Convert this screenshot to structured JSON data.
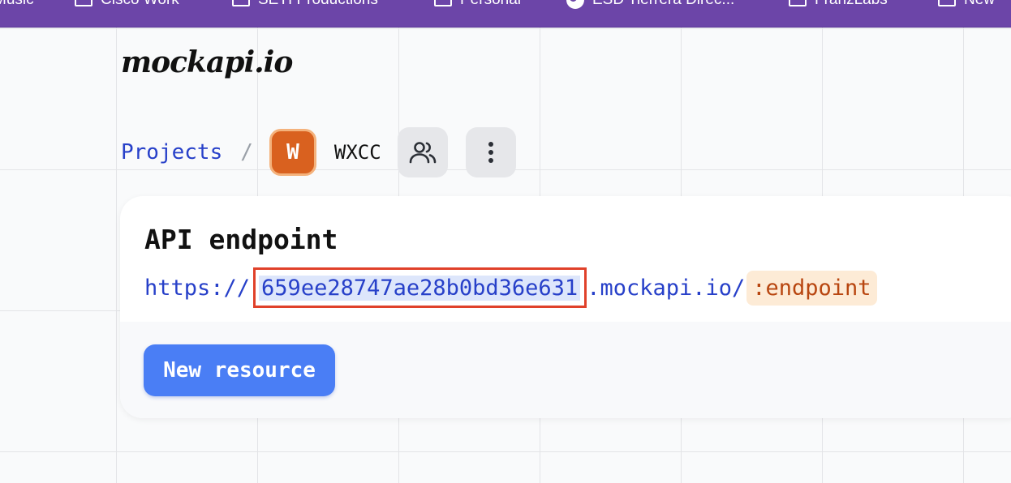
{
  "bookmarks": [
    {
      "label": "Music",
      "icon": "folder-icon"
    },
    {
      "label": "Cisco Work",
      "icon": "folder-icon"
    },
    {
      "label": "SETI Productions",
      "icon": "folder-icon"
    },
    {
      "label": "Personal",
      "icon": "folder-icon"
    },
    {
      "label": "ESD Tierrera Direc...",
      "icon": "globe-icon"
    },
    {
      "label": "FranzLabs",
      "icon": "folder-icon"
    },
    {
      "label": "New",
      "icon": "folder-icon"
    }
  ],
  "logo": "mockapi.io",
  "breadcrumb": {
    "projects_label": "Projects",
    "separator": "/",
    "avatar_letter": "W",
    "project_name": "WXCC",
    "members_icon": "users-icon",
    "menu_icon": "more-vertical-icon"
  },
  "card": {
    "title": "API endpoint",
    "url_scheme": "https://",
    "url_id": "659ee28747ae28b0bd36e631",
    "url_host": ".mockapi.io/",
    "url_endpoint": ":endpoint",
    "new_resource_label": "New resource"
  },
  "colors": {
    "bookmarks_bar": "#6c45a8",
    "link": "#2740c9",
    "avatar": "#d9611f",
    "primary_button": "#4a7ef5",
    "highlight_border": "#e0412a",
    "endpoint_text": "#b84610"
  }
}
